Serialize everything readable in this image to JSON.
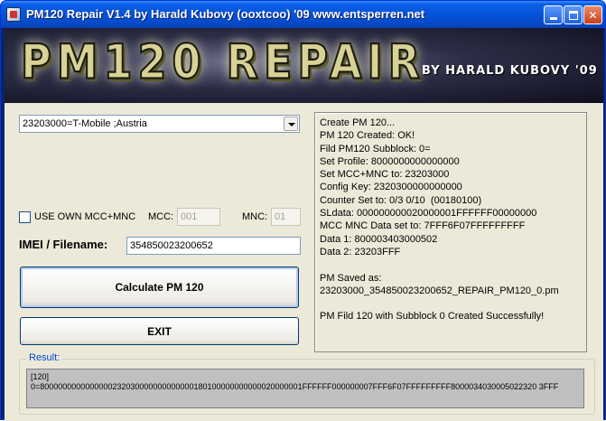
{
  "window": {
    "title": "PM120 Repair  V1.4  by Harald Kubovy (ooxtcoo) '09     www.entsperren.net",
    "minimize_label": "",
    "maximize_label": "",
    "close_label": "✕"
  },
  "banner": {
    "title": "PM120 REPAIR",
    "author": "BY HARALD KUBOVY '09"
  },
  "network_select": {
    "selected": "23203000=T-Mobile ;Austria"
  },
  "own_mcc_mnc": {
    "label": "USE OWN MCC+MNC",
    "checked": false,
    "mcc_label": "MCC:",
    "mcc_value": "001",
    "mnc_label": "MNC:",
    "mnc_value": "01"
  },
  "imei": {
    "label": "IMEI / Filename:",
    "value": "354850023200652"
  },
  "buttons": {
    "calculate": "Calculate PM 120",
    "exit": "EXIT"
  },
  "log": {
    "text": "Create PM 120...\nPM 120 Created: OK!\nFild PM120 Subblock: 0=\nSet Profile: 8000000000000000\nSet MCC+MNC to: 23203000\nConfig Key: 2320300000000000\nCounter Set to: 0/3 0/10  (00180100)\nSLdata: 000000000020000001FFFFFF00000000\nMCC MNC Data set to: 7FFF6F07FFFFFFFFF\nData 1: 800003403000502\nData 2: 23203FFF\n\nPM Saved as:\n23203000_354850023200652_REPAIR_PM120_0.pm\n\nPM Fild 120 with Subblock 0 Created Successfully!"
  },
  "result": {
    "legend": "Result:",
    "text": "[120]\n0=8000000000000000232030000000000000180100000000000020000001FFFFFF000000007FFF6F07FFFFFFFFF8000034030005022320 3FFF"
  },
  "colors": {
    "titlebar": "#0653d8",
    "face": "#ece9d8",
    "group_legend": "#0046d5"
  }
}
